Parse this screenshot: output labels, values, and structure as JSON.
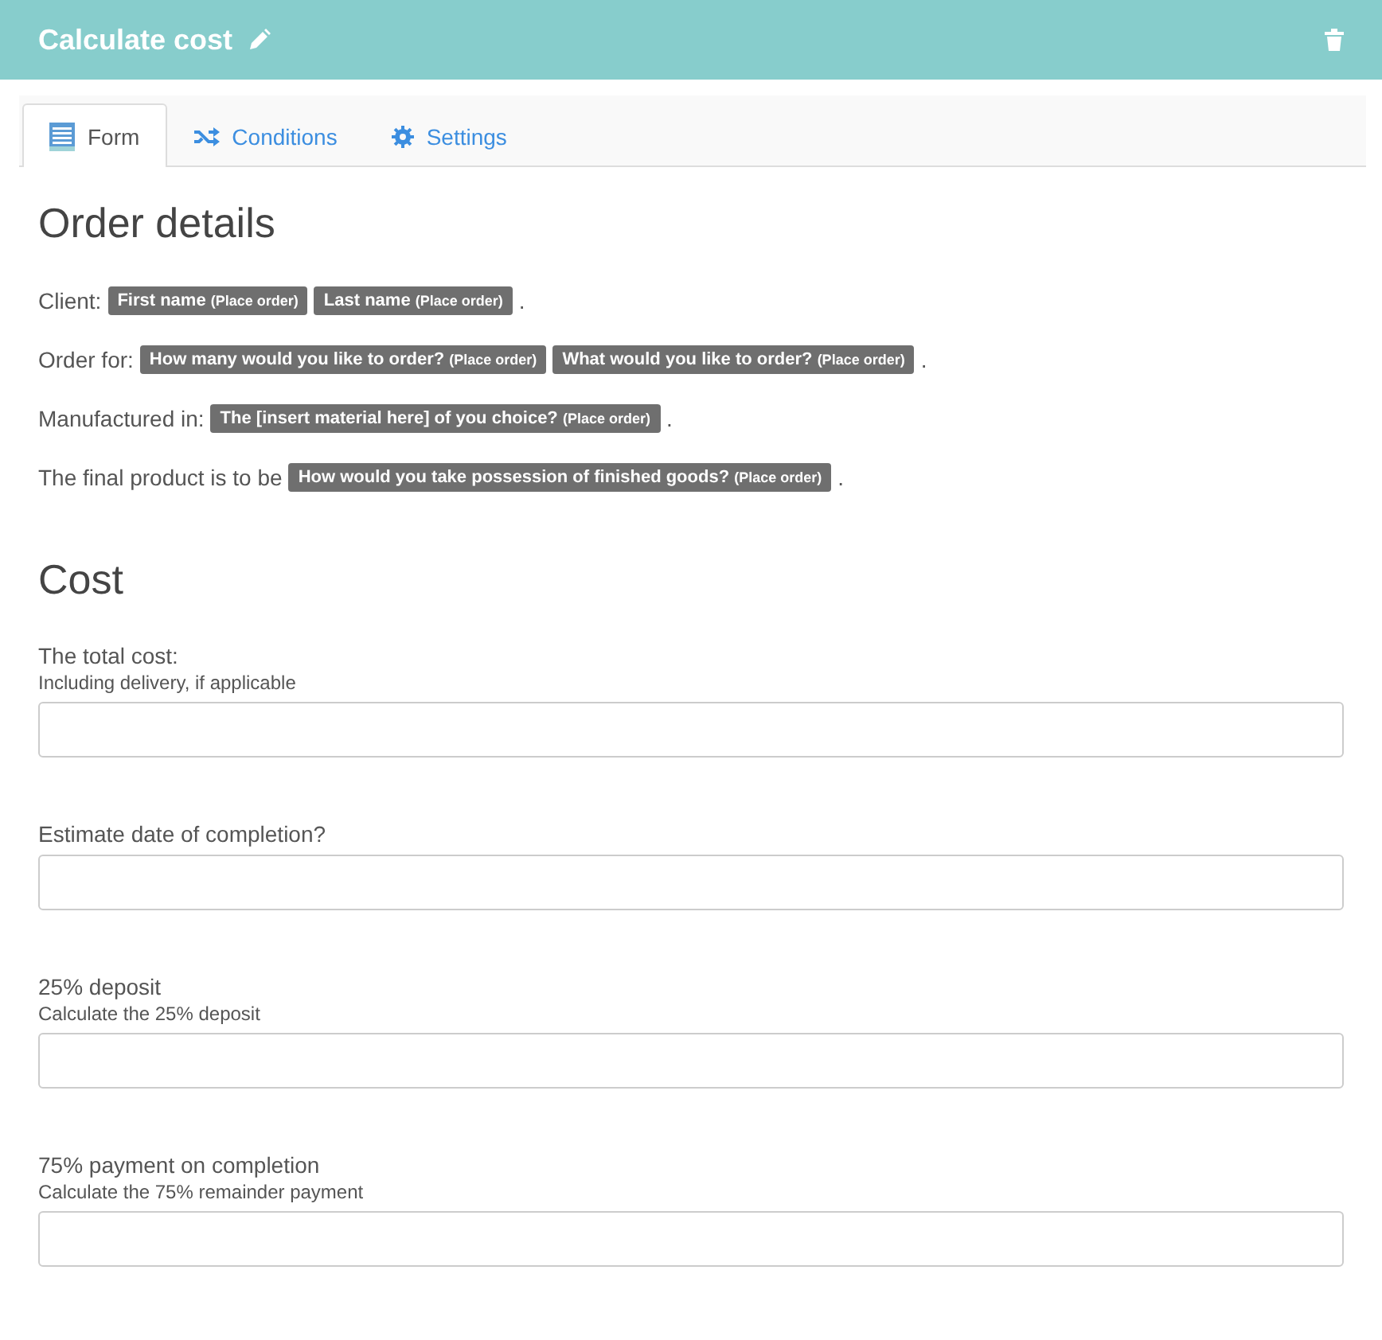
{
  "header": {
    "title": "Calculate cost"
  },
  "tabs": [
    {
      "label": "Form",
      "kind": "form",
      "selected": true
    },
    {
      "label": "Conditions",
      "kind": "conditions",
      "selected": false
    },
    {
      "label": "Settings",
      "kind": "settings",
      "selected": false
    }
  ],
  "sections": [
    {
      "heading": "Order details",
      "lines": [
        {
          "parts": [
            {
              "kind": "text",
              "text": "Client:"
            },
            {
              "kind": "token",
              "text": "First name",
              "source": "(Place order)"
            },
            {
              "kind": "token",
              "text": "Last name",
              "source": "(Place order)"
            },
            {
              "kind": "text",
              "text": "."
            }
          ]
        },
        {
          "parts": [
            {
              "kind": "text",
              "text": "Order for:"
            },
            {
              "kind": "token",
              "text": "How many would you like to order?",
              "source": "(Place order)"
            },
            {
              "kind": "token",
              "text": "What would you like to order?",
              "source": "(Place order)"
            },
            {
              "kind": "text",
              "text": "."
            }
          ]
        },
        {
          "parts": [
            {
              "kind": "text",
              "text": "Manufactured in:"
            },
            {
              "kind": "token",
              "text": "The [insert material here] of you choice?",
              "source": "(Place order)"
            },
            {
              "kind": "text",
              "text": "."
            }
          ]
        },
        {
          "parts": [
            {
              "kind": "text",
              "text": "The final product is to be"
            },
            {
              "kind": "token",
              "text": "How would you take possession of finished goods?",
              "source": "(Place order)"
            },
            {
              "kind": "text",
              "text": "."
            }
          ]
        }
      ]
    },
    {
      "heading": "Cost",
      "fields": [
        {
          "label": "The total cost:",
          "hint": "Including delivery, if applicable"
        },
        {
          "label": "Estimate date of completion?"
        },
        {
          "label": "25% deposit",
          "hint": "Calculate the 25% deposit"
        },
        {
          "label": "75% payment on completion",
          "hint": "Calculate the 75% remainder payment"
        }
      ]
    }
  ]
}
